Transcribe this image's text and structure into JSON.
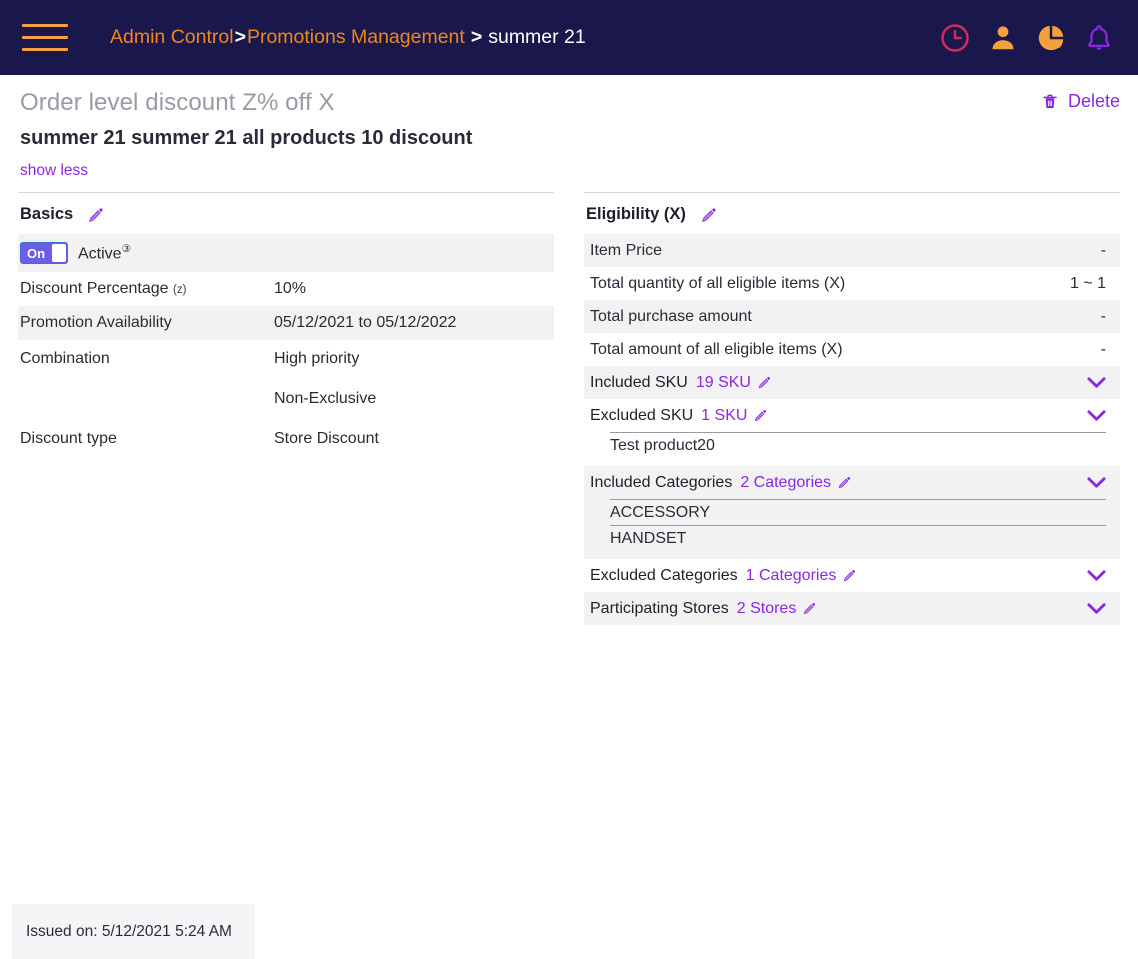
{
  "header": {
    "menu_icon": "hamburger-icon",
    "breadcrumb": {
      "root": "Admin Control",
      "sep1": ">",
      "section": "Promotions Management",
      "sep2": ">",
      "current": "summer 21"
    },
    "icons": [
      {
        "name": "clock-icon",
        "color": "#D42A5B"
      },
      {
        "name": "user-icon",
        "color": "#F5A03C"
      },
      {
        "name": "pie-chart-icon",
        "color": "#F5A03C"
      },
      {
        "name": "bell-icon",
        "color": "#8B27E0"
      }
    ]
  },
  "page": {
    "title": "Order level discount Z% off X",
    "subtitle": "summer 21 summer 21 all products 10 discount",
    "show_less": "show less",
    "delete_label": "Delete",
    "delete_icon": "trash-icon"
  },
  "basics": {
    "heading": "Basics",
    "edit_icon": "pencil-icon",
    "toggle": {
      "state_label": "On",
      "field_label": "Active",
      "help_marker": "?"
    },
    "rows": [
      {
        "label": "Discount Percentage",
        "sub": "(z)",
        "value": "10%"
      },
      {
        "label": "Promotion Availability",
        "sub": "",
        "value": "05/12/2021 to 05/12/2022"
      },
      {
        "label": "Combination",
        "sub": "",
        "value": "High priority",
        "value2": "Non-Exclusive"
      },
      {
        "label": "Discount type",
        "sub": "",
        "value": "Store Discount"
      }
    ]
  },
  "eligibility": {
    "heading": "Eligibility (X)",
    "edit_icon": "pencil-icon",
    "rows": [
      {
        "label": "Item Price",
        "value": "-"
      },
      {
        "label": "Total quantity of all eligible items (X)",
        "value": "1 ~ 1"
      },
      {
        "label": "Total purchase amount",
        "value": "-"
      },
      {
        "label": "Total amount of all eligible items (X)",
        "value": "-"
      }
    ],
    "groups": [
      {
        "label": "Included SKU",
        "link": "19 SKU",
        "edit_icon": "pencil-icon",
        "chevron": "chevron-down-icon",
        "items": []
      },
      {
        "label": "Excluded SKU",
        "link": "1 SKU",
        "edit_icon": "pencil-icon",
        "chevron": "chevron-down-icon",
        "items": [
          "Test product20"
        ]
      },
      {
        "label": "Included Categories",
        "link": "2 Categories",
        "edit_icon": "pencil-icon",
        "chevron": "chevron-down-icon",
        "items": [
          "ACCESSORY",
          "HANDSET"
        ]
      },
      {
        "label": "Excluded Categories",
        "link": "1 Categories",
        "edit_icon": "pencil-icon",
        "chevron": "chevron-down-icon",
        "items": []
      },
      {
        "label": "Participating Stores",
        "link": "2 Stores",
        "edit_icon": "pencil-icon",
        "chevron": "chevron-down-icon",
        "items": []
      }
    ]
  },
  "footer": {
    "issued_on": "Issued on: 5/12/2021 5:24 AM"
  },
  "colors": {
    "navy": "#19174B",
    "orange": "#F0861E",
    "purple": "#8B27E0",
    "stripe": "#F2F2F2"
  }
}
